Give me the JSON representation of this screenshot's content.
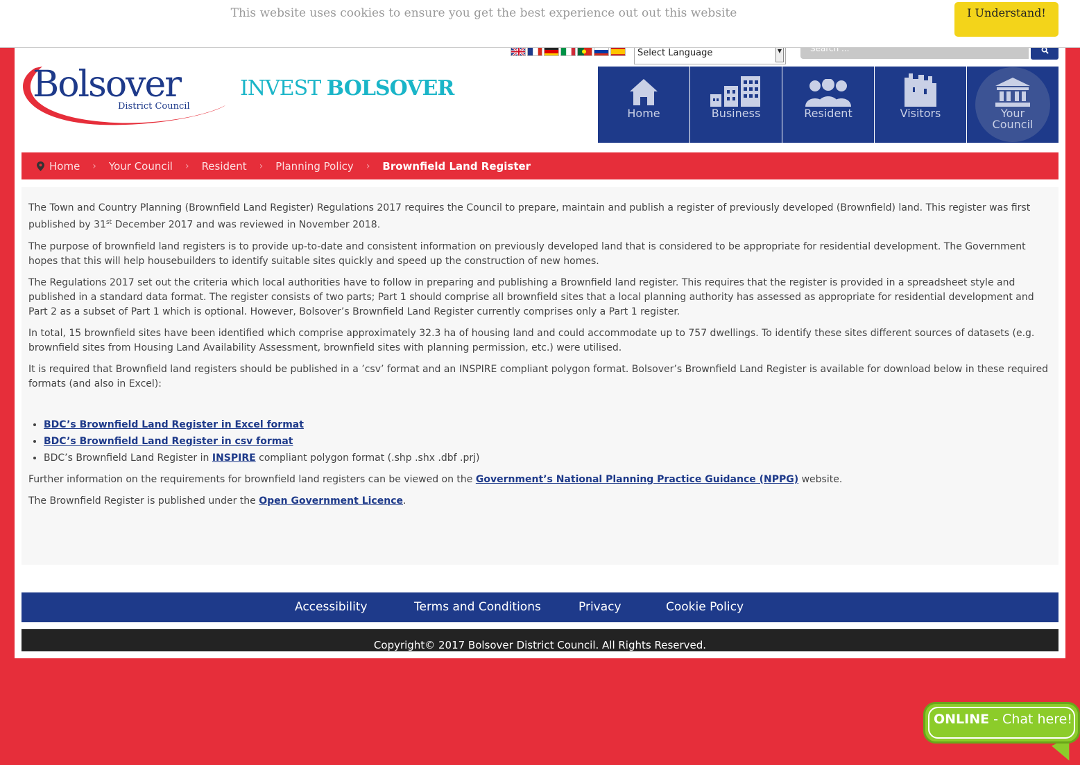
{
  "cookie": {
    "message": "This website uses cookies to ensure you get the best experience out out this website",
    "button_label": "I Understand!"
  },
  "header": {
    "language_select": "Select Language",
    "search_placeholder": "Search ...",
    "logo_word": "Bolsover",
    "logo_sub": "District Council",
    "invest_light": "INVEST",
    "invest_bold": "BOLSOVER",
    "flags": [
      "uk-flag-icon",
      "france-flag-icon",
      "germany-flag-icon",
      "italy-flag-icon",
      "portugal-flag-icon",
      "russia-flag-icon",
      "spain-flag-icon"
    ]
  },
  "nav": {
    "home": "Home",
    "business": "Business",
    "resident": "Resident",
    "visitors": "Visitors",
    "council_line1": "Your",
    "council_line2": "Council"
  },
  "breadcrumb": {
    "items": [
      "Home",
      "Your Council",
      "Resident",
      "Planning Policy"
    ],
    "current": "Brownfield Land Register",
    "separator": "›"
  },
  "content": {
    "p1_a": "The Town and Country Planning (Brownfield Land Register) Regulations 2017 requires the Council to prepare, maintain and publish a register of previously developed (Brownfield) land. This register was first published by 31",
    "p1_sup": "st",
    "p1_b": " December 2017 and was reviewed in November 2018.",
    "p2": "The purpose of brownfield land registers is to provide up-to-date and consistent information on previously developed land that is considered to be appropriate for residential development. The Government hopes that this will help housebuilders to identify suitable sites quickly and speed up the construction of new homes.",
    "p3": "The Regulations 2017 set out the criteria which local authorities have to follow in preparing and publishing a Brownfield land register. This requires that the register is provided in a spreadsheet style and published in a standard data format. The register consists of two parts; Part 1 should comprise all brownfield sites that a local planning authority has assessed as appropriate for residential development and Part 2 as a subset of Part 1 which is optional. However, Bolsover’s Brownfield Land Register currently comprises only a Part 1 register.",
    "p4": "In total, 15 brownfield sites have been identified which comprise approximately 32.3 ha of housing land and could accommodate up to 757 dwellings. To identify these sites different sources of datasets (e.g. brownfield sites from Housing Land Availability Assessment, brownfield sites with planning permission, etc.) were utilised.",
    "p5": "It is required that Brownfield land registers should be published in a ’csv’ format and an INSPIRE compliant polygon format. Bolsover’s Brownfield Land Register is available for download below in these required formats (and also in Excel):",
    "link_excel": "BDC’s Brownfield Land Register in Excel format",
    "link_csv": "BDC’s Brownfield Land Register in csv format",
    "li3_a": "BDC’s Brownfield Land Register in ",
    "li3_link": "INSPIRE",
    "li3_b": " compliant polygon format (.shp .shx .dbf .prj)",
    "p6_a": "Further information on the requirements for brownfield land registers can be viewed on the ",
    "p6_link": "Government’s National Planning Practice Guidance (NPPG)",
    "p6_b": " website.",
    "p7_a": "The Brownfield Register is published under the ",
    "p7_link": "Open Government Licence",
    "p7_b": "."
  },
  "footer": {
    "accessibility": "Accessibility",
    "terms": "Terms and Conditions",
    "privacy": "Privacy",
    "cookie_policy": "Cookie Policy",
    "copyright": "Copyright© 2017 Bolsover District Council. All Rights Reserved."
  },
  "chat": {
    "online": "ONLINE",
    "rest": " - Chat here!"
  },
  "colors": {
    "brand_red": "#e62e3a",
    "brand_blue": "#1e3a8a",
    "invest_teal": "#1ab5c8",
    "cookie_button": "#f3d41a",
    "chat_green": "#8ccc2a"
  }
}
